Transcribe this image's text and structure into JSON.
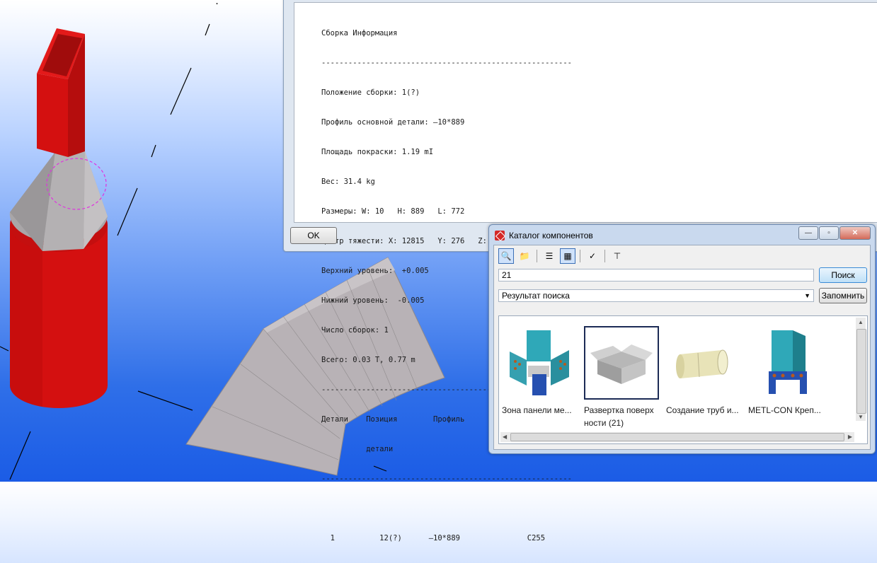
{
  "report": {
    "lines": [
      "Сборка Информация",
      "--------------------------------------------------------",
      "Положение сборки: 1(?)",
      "Профиль основной детали: —10*889",
      "Площадь покраски: 1.19 mI",
      "Вес: 31.4 kg",
      "Размеры: W: 10   H: 889   L: 772",
      "Центр тяжести: X: 12815   Y: 276   Z: -0",
      "Верхний уровень:  +0.005",
      "Нижний уровень:  -0.005",
      "Число сборок: 1",
      "Всего: 0.03 T, 0.77 m",
      "--------------------------------------------------------",
      "Детали    Позиция        Профиль             Материал",
      "          детали",
      "--------------------------------------------------------",
      "",
      "  1          12(?)      —10*889               C255"
    ],
    "ok_label": "OK"
  },
  "catalog": {
    "title": "Каталог компонентов",
    "search_value": "21",
    "search_label": "Поиск",
    "dropdown_value": "Результат поиска",
    "remember_label": "Запомнить",
    "items": [
      {
        "label": "Зона панели ме..."
      },
      {
        "label": "Развертка поверх ности (21)"
      },
      {
        "label": "Создание труб и..."
      },
      {
        "label": "METL-CON Креп..."
      }
    ]
  },
  "colors": {
    "tube_red": "#d41010",
    "sheet_gray": "#b8b2b6",
    "bg_blue": "#2f6fe8"
  }
}
